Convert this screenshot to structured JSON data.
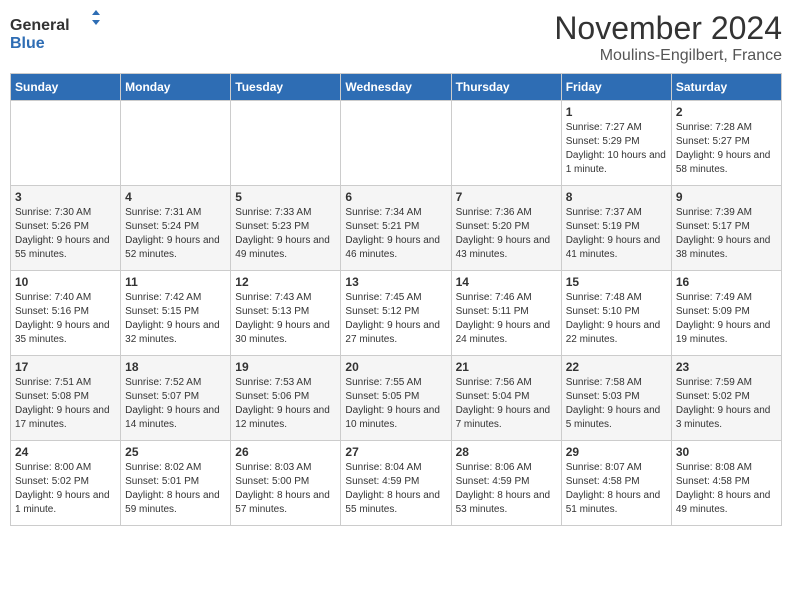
{
  "logo": {
    "line1": "General",
    "line2": "Blue"
  },
  "title": "November 2024",
  "location": "Moulins-Engilbert, France",
  "weekdays": [
    "Sunday",
    "Monday",
    "Tuesday",
    "Wednesday",
    "Thursday",
    "Friday",
    "Saturday"
  ],
  "weeks": [
    [
      {
        "day": "",
        "info": ""
      },
      {
        "day": "",
        "info": ""
      },
      {
        "day": "",
        "info": ""
      },
      {
        "day": "",
        "info": ""
      },
      {
        "day": "",
        "info": ""
      },
      {
        "day": "1",
        "info": "Sunrise: 7:27 AM\nSunset: 5:29 PM\nDaylight: 10 hours and 1 minute."
      },
      {
        "day": "2",
        "info": "Sunrise: 7:28 AM\nSunset: 5:27 PM\nDaylight: 9 hours and 58 minutes."
      }
    ],
    [
      {
        "day": "3",
        "info": "Sunrise: 7:30 AM\nSunset: 5:26 PM\nDaylight: 9 hours and 55 minutes."
      },
      {
        "day": "4",
        "info": "Sunrise: 7:31 AM\nSunset: 5:24 PM\nDaylight: 9 hours and 52 minutes."
      },
      {
        "day": "5",
        "info": "Sunrise: 7:33 AM\nSunset: 5:23 PM\nDaylight: 9 hours and 49 minutes."
      },
      {
        "day": "6",
        "info": "Sunrise: 7:34 AM\nSunset: 5:21 PM\nDaylight: 9 hours and 46 minutes."
      },
      {
        "day": "7",
        "info": "Sunrise: 7:36 AM\nSunset: 5:20 PM\nDaylight: 9 hours and 43 minutes."
      },
      {
        "day": "8",
        "info": "Sunrise: 7:37 AM\nSunset: 5:19 PM\nDaylight: 9 hours and 41 minutes."
      },
      {
        "day": "9",
        "info": "Sunrise: 7:39 AM\nSunset: 5:17 PM\nDaylight: 9 hours and 38 minutes."
      }
    ],
    [
      {
        "day": "10",
        "info": "Sunrise: 7:40 AM\nSunset: 5:16 PM\nDaylight: 9 hours and 35 minutes."
      },
      {
        "day": "11",
        "info": "Sunrise: 7:42 AM\nSunset: 5:15 PM\nDaylight: 9 hours and 32 minutes."
      },
      {
        "day": "12",
        "info": "Sunrise: 7:43 AM\nSunset: 5:13 PM\nDaylight: 9 hours and 30 minutes."
      },
      {
        "day": "13",
        "info": "Sunrise: 7:45 AM\nSunset: 5:12 PM\nDaylight: 9 hours and 27 minutes."
      },
      {
        "day": "14",
        "info": "Sunrise: 7:46 AM\nSunset: 5:11 PM\nDaylight: 9 hours and 24 minutes."
      },
      {
        "day": "15",
        "info": "Sunrise: 7:48 AM\nSunset: 5:10 PM\nDaylight: 9 hours and 22 minutes."
      },
      {
        "day": "16",
        "info": "Sunrise: 7:49 AM\nSunset: 5:09 PM\nDaylight: 9 hours and 19 minutes."
      }
    ],
    [
      {
        "day": "17",
        "info": "Sunrise: 7:51 AM\nSunset: 5:08 PM\nDaylight: 9 hours and 17 minutes."
      },
      {
        "day": "18",
        "info": "Sunrise: 7:52 AM\nSunset: 5:07 PM\nDaylight: 9 hours and 14 minutes."
      },
      {
        "day": "19",
        "info": "Sunrise: 7:53 AM\nSunset: 5:06 PM\nDaylight: 9 hours and 12 minutes."
      },
      {
        "day": "20",
        "info": "Sunrise: 7:55 AM\nSunset: 5:05 PM\nDaylight: 9 hours and 10 minutes."
      },
      {
        "day": "21",
        "info": "Sunrise: 7:56 AM\nSunset: 5:04 PM\nDaylight: 9 hours and 7 minutes."
      },
      {
        "day": "22",
        "info": "Sunrise: 7:58 AM\nSunset: 5:03 PM\nDaylight: 9 hours and 5 minutes."
      },
      {
        "day": "23",
        "info": "Sunrise: 7:59 AM\nSunset: 5:02 PM\nDaylight: 9 hours and 3 minutes."
      }
    ],
    [
      {
        "day": "24",
        "info": "Sunrise: 8:00 AM\nSunset: 5:02 PM\nDaylight: 9 hours and 1 minute."
      },
      {
        "day": "25",
        "info": "Sunrise: 8:02 AM\nSunset: 5:01 PM\nDaylight: 8 hours and 59 minutes."
      },
      {
        "day": "26",
        "info": "Sunrise: 8:03 AM\nSunset: 5:00 PM\nDaylight: 8 hours and 57 minutes."
      },
      {
        "day": "27",
        "info": "Sunrise: 8:04 AM\nSunset: 4:59 PM\nDaylight: 8 hours and 55 minutes."
      },
      {
        "day": "28",
        "info": "Sunrise: 8:06 AM\nSunset: 4:59 PM\nDaylight: 8 hours and 53 minutes."
      },
      {
        "day": "29",
        "info": "Sunrise: 8:07 AM\nSunset: 4:58 PM\nDaylight: 8 hours and 51 minutes."
      },
      {
        "day": "30",
        "info": "Sunrise: 8:08 AM\nSunset: 4:58 PM\nDaylight: 8 hours and 49 minutes."
      }
    ]
  ]
}
